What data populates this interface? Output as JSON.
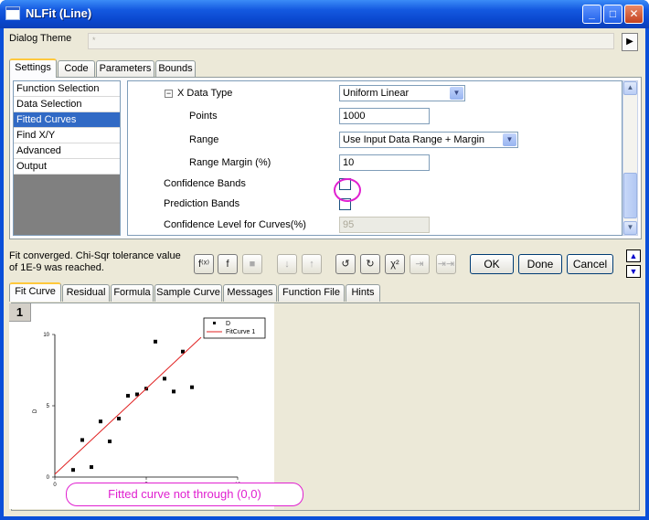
{
  "window": {
    "title": "NLFit (Line)",
    "minimize": "_",
    "maximize": "□",
    "close": "✕"
  },
  "theme": {
    "label": "Dialog Theme",
    "value": "*",
    "arrow": "▶"
  },
  "top_tabs": [
    "Settings",
    "Code",
    "Parameters",
    "Bounds"
  ],
  "nav": {
    "items": [
      "Function Selection",
      "Data Selection",
      "Fitted Curves",
      "Find X/Y",
      "Advanced",
      "Output"
    ],
    "selected_index": 2
  },
  "settings": {
    "x_data_type": {
      "label": "X Data Type",
      "value": "Uniform Linear"
    },
    "points": {
      "label": "Points",
      "value": "1000"
    },
    "range": {
      "label": "Range",
      "value": "Use Input Data Range + Margin"
    },
    "range_margin": {
      "label": "Range Margin (%)",
      "value": "10"
    },
    "confidence_bands": {
      "label": "Confidence Bands",
      "checked": false
    },
    "prediction_bands": {
      "label": "Prediction Bands",
      "checked": false
    },
    "confidence_level": {
      "label": "Confidence Level for Curves(%)",
      "value": "95"
    }
  },
  "status": {
    "line1": "Fit converged. Chi-Sqr tolerance value",
    "line2": "of 1E-9 was reached."
  },
  "toolbar": {
    "icons": [
      "fit-formula-icon",
      "function-file-icon",
      "save-icon",
      "sort-down-icon",
      "sort-up-icon",
      "iterate-one-icon",
      "iterate-simplex-icon",
      "chi-square-icon",
      "step-icon",
      "fit-until-converged-icon"
    ],
    "chi_symbol": "χ²",
    "ok": "OK",
    "done": "Done",
    "cancel": "Cancel"
  },
  "bottom_tabs": [
    "Fit Curve",
    "Residual",
    "Formula",
    "Sample Curve",
    "Messages",
    "Function File",
    "Hints"
  ],
  "preview": {
    "page_number": "1",
    "legend": [
      "D",
      "FitCurve 1"
    ],
    "callout": "Fitted curve not through (0,0)"
  },
  "chart_data": {
    "type": "scatter",
    "ylabel": "D",
    "xlim": [
      0,
      10
    ],
    "ylim": [
      0,
      10
    ],
    "x_ticks": [
      "0",
      "5",
      "10"
    ],
    "y_ticks": [
      "0",
      "5",
      "10"
    ],
    "series": [
      {
        "name": "D",
        "kind": "scatter",
        "x": [
          1,
          1.5,
          2,
          2.5,
          3,
          3.5,
          4,
          4.5,
          5,
          5.5,
          6,
          6.5,
          7,
          7.5
        ],
        "y": [
          0.5,
          2.6,
          0.7,
          3.9,
          2.5,
          4.1,
          5.7,
          5.8,
          6.2,
          9.5,
          6.9,
          6.0,
          8.8,
          6.3
        ]
      },
      {
        "name": "FitCurve 1",
        "kind": "line",
        "x": [
          0,
          8
        ],
        "y": [
          0.2,
          9.8
        ]
      }
    ],
    "legend_position": "top-right",
    "colors": {
      "points": "#000000",
      "line": "#e02020"
    }
  }
}
